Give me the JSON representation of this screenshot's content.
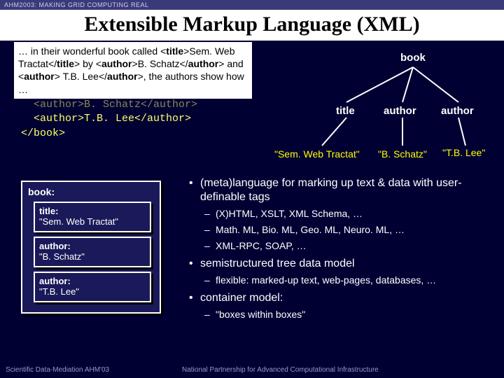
{
  "header": "AHM2003: MAKING GRID COMPUTING REAL",
  "title": "Extensible Markup Language (XML)",
  "paragraph": {
    "pre": "… in their wonderful book called <",
    "title_open": "title",
    "title_val": "Sem. Web Tractat",
    "title_close": "title",
    "mid1": " by <",
    "auth_open": "author",
    "auth1": "B. Schatz",
    "auth_close": "author",
    "mid2": " and <",
    "auth2": " T.B. Lee",
    "post": ">, the authors show how …"
  },
  "code": {
    "line1": "<author>T.B. Lee</author>",
    "line2": "</book>"
  },
  "tree": {
    "root": "book",
    "c1": "title",
    "c2": "author",
    "c3": "author",
    "v1": "\"Sem. Web Tractat\"",
    "v2": "\"B. Schatz\"",
    "v3": "\"T.B. Lee\""
  },
  "nested": {
    "root": "book:",
    "box1_lbl": "title:",
    "box1_val": "\"Sem. Web Tractat\"",
    "box2_lbl": "author:",
    "box2_val": "\"B. Schatz\"",
    "box3_lbl": "author:",
    "box3_val": "\"T.B. Lee\""
  },
  "bullets": {
    "b1": "(meta)language for marking up text & data with user-definable tags",
    "b1a": "(X)HTML, XSLT, XML Schema, …",
    "b1b": "Math. ML, Bio. ML, Geo. ML, Neuro. ML, …",
    "b1c": "XML-RPC, SOAP, …",
    "b2": "semistructured tree data model",
    "b2a": "flexible: marked-up text, web-pages, databases, …",
    "b3": "container model:",
    "b3a": "\"boxes within boxes\""
  },
  "footer": {
    "left": "Scientific Data-Mediation AHM'03",
    "right": "National Partnership for Advanced Computational Infrastructure"
  }
}
